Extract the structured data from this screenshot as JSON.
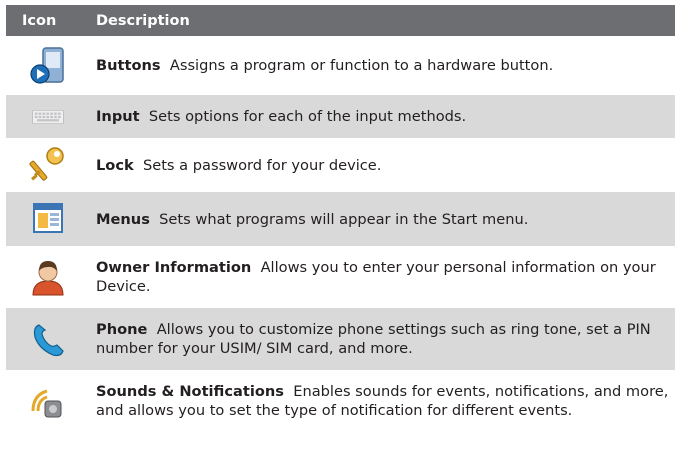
{
  "header": {
    "col_icon": "Icon",
    "col_description": "Description"
  },
  "rows": [
    {
      "icon": "buttons-icon",
      "title": "Buttons",
      "text": "Assigns a program or function to a hardware button."
    },
    {
      "icon": "keyboard-icon",
      "title": "Input",
      "text": "Sets options for each of the input methods."
    },
    {
      "icon": "key-icon",
      "title": "Lock",
      "text": "Sets a password for your device."
    },
    {
      "icon": "menu-window-icon",
      "title": "Menus",
      "text": "Sets what programs will appear in the Start menu."
    },
    {
      "icon": "person-icon",
      "title": "Owner Information",
      "text": "Allows you to enter your personal information on your Device."
    },
    {
      "icon": "phone-handset-icon",
      "title": "Phone",
      "text": "Allows you to customize phone settings such as ring tone, set a PIN number for your USIM/ SIM card, and more."
    },
    {
      "icon": "sound-waves-icon",
      "title": "Sounds & Notifications",
      "text": "Enables sounds for events, notifications, and more, and allows you to set the type of notification for different events."
    }
  ],
  "colors": {
    "header_bg": "#6d6e71",
    "alt_row_bg": "#d9d9da",
    "text": "#231f20"
  }
}
